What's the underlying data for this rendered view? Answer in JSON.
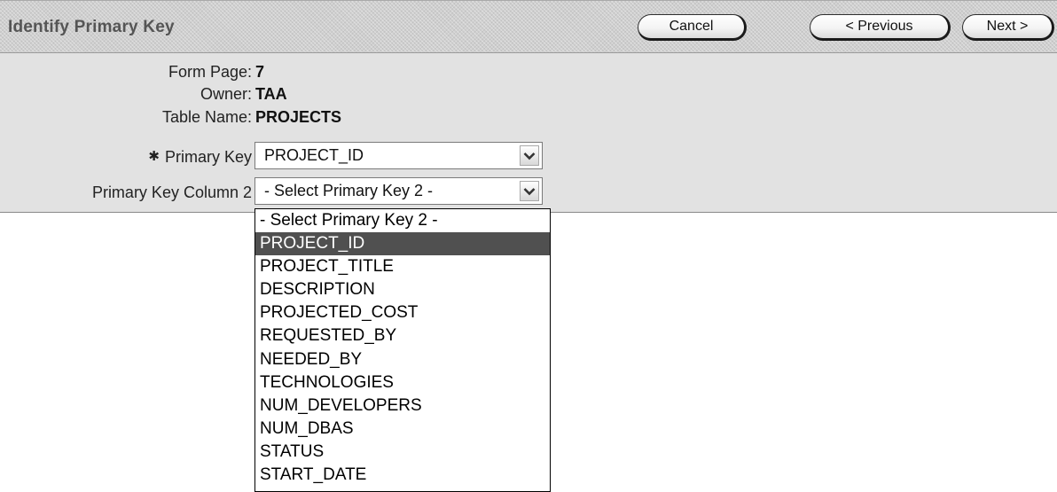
{
  "region": {
    "title": "Identify Primary Key"
  },
  "buttons": {
    "cancel": "Cancel",
    "previous": "< Previous",
    "next": "Next >"
  },
  "form": {
    "form_page_label": "Form Page:",
    "form_page_value": "7",
    "owner_label": "Owner:",
    "owner_value": "TAA",
    "table_name_label": "Table Name:",
    "table_name_value": "PROJECTS",
    "required_marker": "✱",
    "primary_key_label": "Primary Key",
    "primary_key_value": "PROJECT_ID",
    "primary_key_2_label": "Primary Key Column 2",
    "primary_key_2_value": "- Select Primary Key 2 -"
  },
  "dropdown": {
    "highlighted": "PROJECT_ID",
    "options": [
      "- Select Primary Key 2 -",
      "PROJECT_ID",
      "PROJECT_TITLE",
      "DESCRIPTION",
      "PROJECTED_COST",
      "REQUESTED_BY",
      "NEEDED_BY",
      "TECHNOLOGIES",
      "NUM_DEVELOPERS",
      "NUM_DBAS",
      "STATUS",
      "START_DATE"
    ]
  },
  "colors": {
    "header_bg": "#cfcfcf",
    "body_bg": "#e2e2e2",
    "highlight_bg": "#505050",
    "title_text": "#555555"
  },
  "icons": {
    "select_arrow": "chevron-down-icon",
    "required": "asterisk-icon"
  }
}
